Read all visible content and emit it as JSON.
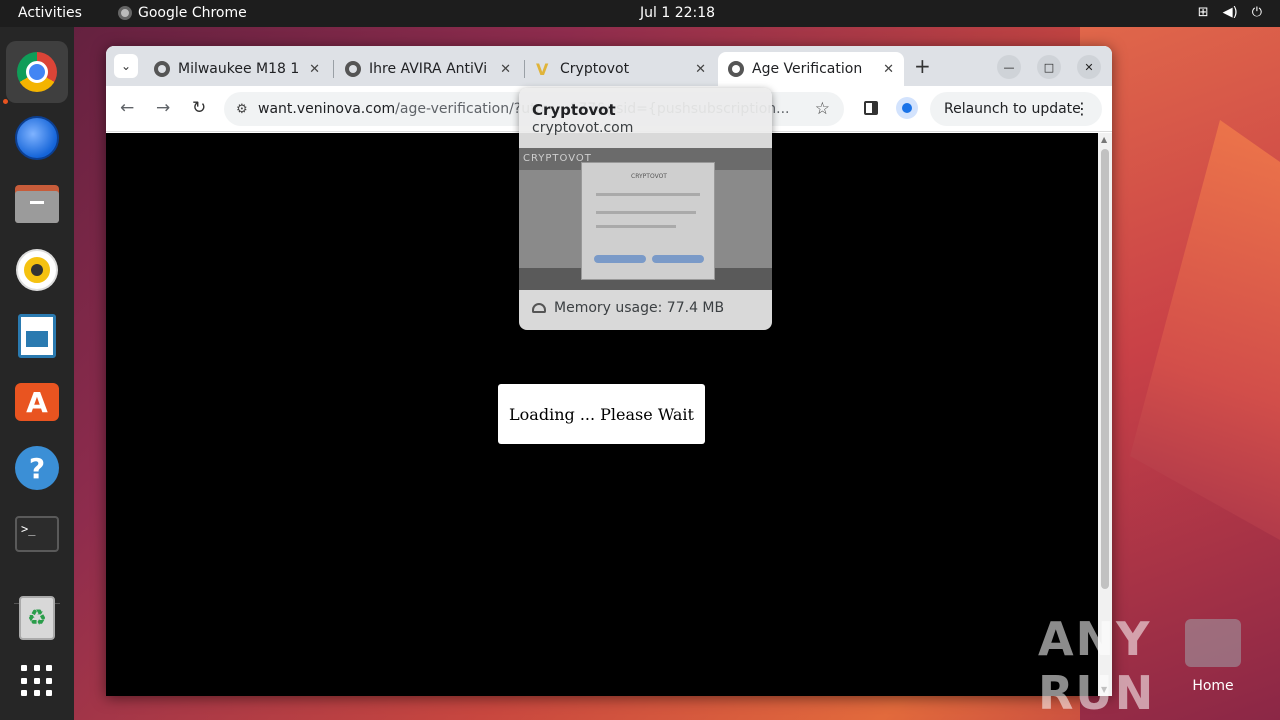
{
  "topbar": {
    "activities": "Activities",
    "app_name": "Google Chrome",
    "clock": "Jul 1  22:18",
    "tray_icons": [
      "network-icon",
      "volume-icon",
      "power-icon"
    ]
  },
  "dock": {
    "items": [
      "google-chrome",
      "thunderbird",
      "files",
      "rhythmbox",
      "libreoffice-writer",
      "app-center",
      "help",
      "terminal",
      "trash",
      "show-apps"
    ],
    "accent": "#e95420"
  },
  "browser": {
    "tabs": [
      {
        "title": "Milwaukee M18 1",
        "favicon": "globe-icon"
      },
      {
        "title": "Ihre AVIRA AntiVi",
        "favicon": "globe-icon"
      },
      {
        "title": "Cryptovot",
        "favicon": "cryptovot-v-icon"
      },
      {
        "title": "Age Verification",
        "favicon": "globe-icon",
        "active": true
      }
    ],
    "new_tab": "+",
    "url_host": "want.veninova.com",
    "url_path": "/age-verification/?utm_...177&psid={pushsubscription...",
    "relaunch": "Relaunch to update",
    "hover_card": {
      "title": "Cryptovot",
      "domain": "cryptovot.com",
      "thumb_logo": "CRYPTOVOT",
      "thumb_dialog_title": "CRYPTOVOT",
      "memory": "Memory usage: 77.4 MB"
    }
  },
  "page": {
    "loading_text": "Loading ... Please Wait",
    "background": "#000000"
  },
  "desktop": {
    "watermark": "ANY RUN",
    "home_label": "Home"
  }
}
